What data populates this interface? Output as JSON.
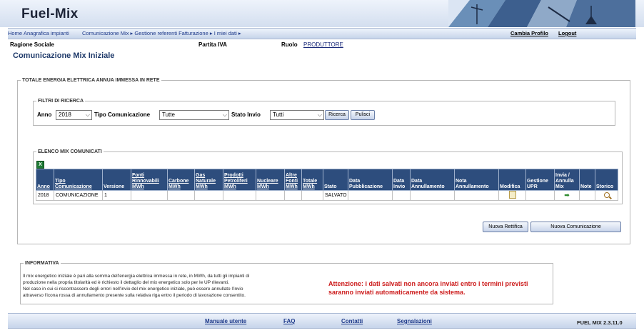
{
  "app": {
    "title": "Fuel-Mix"
  },
  "breadcrumb": [
    {
      "label": "Home"
    },
    {
      "label": "Anagrafica impianti"
    },
    {
      "label": "Comunicazione Mix ▸ Gestione referenti Fatturazione ▸ I miei dati ▸"
    }
  ],
  "nav": {
    "cambia_profilo": "Cambia Profilo",
    "logout": "Logout"
  },
  "info": {
    "ragione_sociale_label": "Ragione Sociale",
    "partita_iva_label": "Partita IVA",
    "ruolo_label": "Ruolo",
    "ruolo_value": "PRODUTTORE"
  },
  "page": {
    "title": "Comunicazione Mix Iniziale"
  },
  "section_totale": {
    "legend": "TOTALE ENERGIA ELETTRICA ANNUA IMMESSA IN RETE"
  },
  "filters": {
    "legend": "FILTRI DI RICERCA",
    "anno_label": "Anno",
    "anno_value": "2018",
    "tipo_label": "Tipo Comunicazione",
    "tipo_value": "Tutte",
    "stato_label": "Stato Invio",
    "stato_value": "Tutti",
    "ricerca_button": "Ricerca",
    "pulisci_button": "Pulisci"
  },
  "elenco": {
    "legend": "ELENCO MIX COMUNICATI",
    "excel_icon": "excel-icon",
    "columns": [
      "Anno",
      "Tipo Comunicazione",
      "Versione",
      "Fonti Rinnovabili MWh",
      "Carbone MWh",
      "Gas Naturale MWh",
      "Prodotti Petroliferi MWh",
      "Nucleare MWh",
      "Altre Fonti MWh",
      "Totale MWh",
      "Stato",
      "Data Pubblicazione",
      "Data Invio",
      "Data Annullamento",
      "Nota Annullamento",
      "Modifica",
      "Gestione UPR",
      "Invia / Annulla Mix",
      "Note",
      "Storico"
    ],
    "rows": [
      {
        "anno": "2018",
        "tipo": "COMUNICAZIONE",
        "versione": "1",
        "stato": "SALVATO",
        "icons": {
          "modifica": "edit-icon",
          "invia": "arrow-right-icon",
          "storico": "magnifier-icon"
        }
      }
    ]
  },
  "actions": {
    "nuova_rettifica": "Nuova Rettifica",
    "nuova_comunicazione": "Nuova Comunicazione"
  },
  "informativa": {
    "legend": "INFORMATIVA",
    "text": [
      "Il mix energetico iniziale è pari alla somma dell'energia elettrica immessa in rete, in MWh, da tutti gli impianti di",
      "produzione nella propria titolarità ed è richiesto il dettaglio del mix energetico solo per le UP rilevanti.",
      "Nel caso in cui si riscontrassero degli errori nell'invio del mix energetico iniziale, può essere annullato l'invio",
      "attraverso l'icona rossa di annullamento presente sulla relativa riga entro il periodo di lavorazione consentito."
    ],
    "warning": "Attenzione: i dati salvati non ancora inviati entro i termini previsti saranno inviati automaticamente da sistema."
  },
  "footer": {
    "links": [
      "Manuale utente",
      "FAQ",
      "Contatti",
      "Segnalazioni"
    ],
    "version": "FUEL MIX 2.3.11.0"
  }
}
